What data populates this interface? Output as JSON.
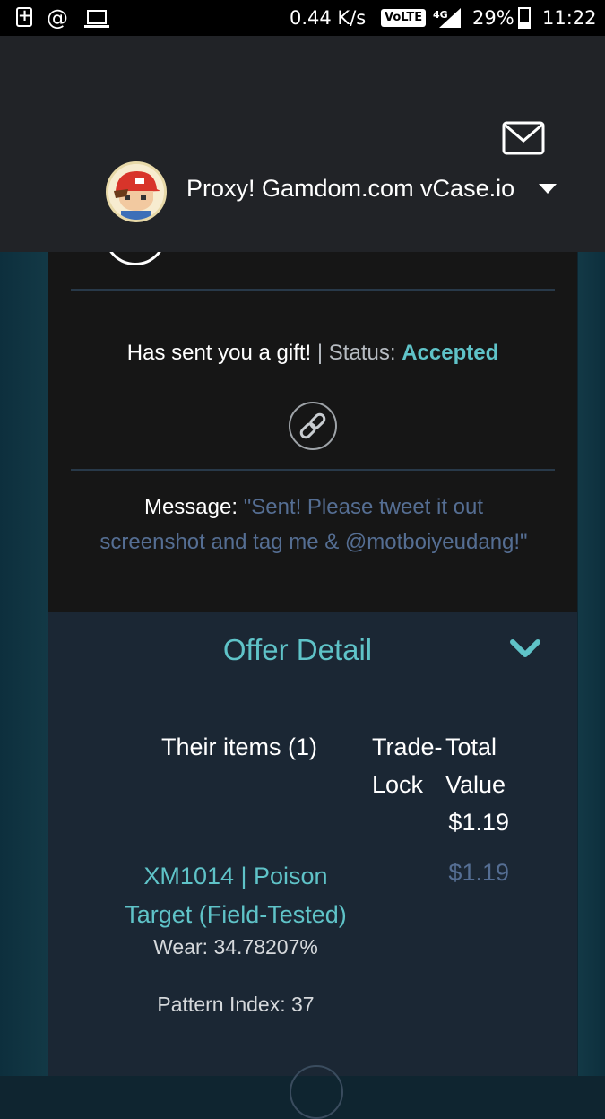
{
  "status_bar": {
    "speed": "0.44 K/s",
    "volte": "VoLTE",
    "network": "4G",
    "battery": "29%",
    "battery_level": 0.29,
    "time": "11:22"
  },
  "header": {
    "user_name": "Proxy! Gamdom.com vCase.io",
    "icons": [
      "mail-icon",
      "avatar",
      "caret-down-icon"
    ]
  },
  "card": {
    "gift_text": "Has sent you a gift!",
    "separator": "|",
    "status_label": "Status:",
    "status_value": "Accepted",
    "message_label": "Message:",
    "message_text": "\"Sent! Please tweet it out screenshot and tag me & @motboiyeudang!\""
  },
  "offer": {
    "title": "Offer Detail",
    "their_items_label": "Their items (1)",
    "trade_lock_label": "Trade- Lock",
    "total_value_label": "Total Value",
    "total_value": "$1.19",
    "items": [
      {
        "name": "XM1014 | Poison Target (Field-Tested)",
        "wear": "Wear: 34.78207%",
        "pattern": "Pattern Index: 37",
        "price": "$1.19"
      }
    ]
  },
  "colors": {
    "accent": "#5fc3c8",
    "muted_link": "#556e93",
    "header_bg": "#212327",
    "panel_bg": "#1b2734"
  }
}
